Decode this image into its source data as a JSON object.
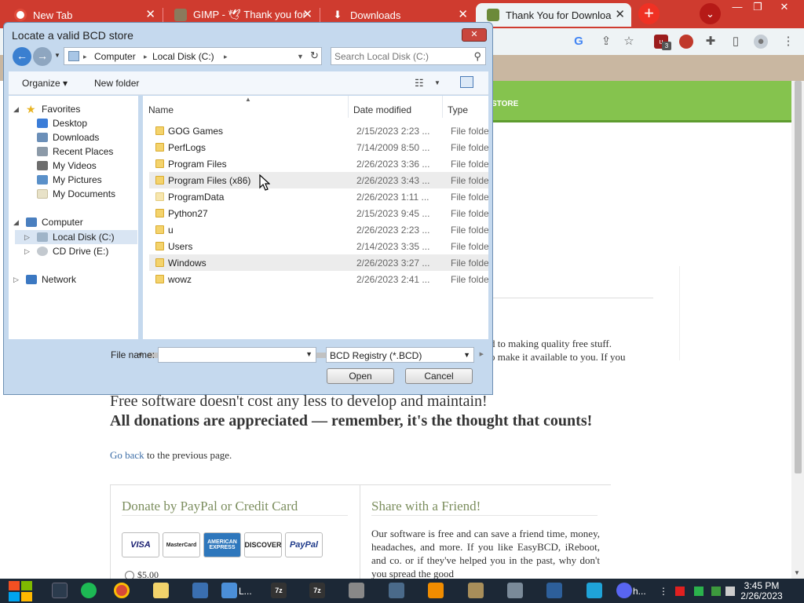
{
  "browser": {
    "tabs": [
      {
        "title": "New Tab",
        "active": false
      },
      {
        "title": "GIMP - 🕊 Thank you for",
        "active": false
      },
      {
        "title": "Downloads",
        "active": false
      },
      {
        "title": "Thank You for Downloa",
        "active": true
      }
    ],
    "new_tab_symbol": "+",
    "tab_menu_symbol": "⌄",
    "extension_badge": "3",
    "window_controls": {
      "minimize": "—",
      "restore": "❐",
      "close": "✕"
    }
  },
  "webpage": {
    "nav_banner_text": "STORE",
    "partial_text_line1": "d to making quality free stuff.",
    "partial_text_line2": "o make it available to you. If you",
    "free_line": "Free software doesn't cost any less to develop and maintain!",
    "donate_line": "All donations are appreciated — remember, it's the thought that counts!",
    "go_back_link": "Go back",
    "go_back_suffix": " to the previous page.",
    "donate_box": {
      "title": "Donate by PayPal or Credit Card",
      "cards": [
        "VISA",
        "MasterCard",
        "AMERICAN EXPRESS",
        "DISCOVER",
        "PayPal"
      ],
      "amount_option": "$5.00"
    },
    "share_box": {
      "title": "Share with a Friend!",
      "text": "Our software is free and can save a friend time, money, headaches, and more. If you like EasyBCD, iReboot, and co. or if they've helped you in the past, why don't you spread the good"
    }
  },
  "dialog": {
    "title": "Locate a valid BCD store",
    "close_symbol": "✕",
    "address_path": [
      "Computer",
      "Local Disk (C:)"
    ],
    "address_separator": "▸",
    "search_placeholder": "Search Local Disk (C:)",
    "toolbar": {
      "organize": "Organize ▾",
      "new_folder": "New folder"
    },
    "nav_tree": {
      "favorites": "Favorites",
      "favorites_items": [
        "Desktop",
        "Downloads",
        "Recent Places",
        "My Videos",
        "My Pictures",
        "My Documents"
      ],
      "computer": "Computer",
      "computer_items": [
        "Local Disk (C:)",
        "CD Drive (E:)"
      ],
      "network": "Network"
    },
    "columns": {
      "name": "Name",
      "date_modified": "Date modified",
      "type": "Type"
    },
    "files": [
      {
        "name": "GOG Games",
        "date": "2/15/2023 2:23 ...",
        "type": "File folder"
      },
      {
        "name": "PerfLogs",
        "date": "7/14/2009 8:50 ...",
        "type": "File folder"
      },
      {
        "name": "Program Files",
        "date": "2/26/2023 3:36 ...",
        "type": "File folder"
      },
      {
        "name": "Program Files (x86)",
        "date": "2/26/2023 3:43 ...",
        "type": "File folder"
      },
      {
        "name": "ProgramData",
        "date": "2/26/2023 1:11 ...",
        "type": "File folder"
      },
      {
        "name": "Python27",
        "date": "2/15/2023 9:45 ...",
        "type": "File folder"
      },
      {
        "name": "u",
        "date": "2/26/2023 2:23 ...",
        "type": "File folder"
      },
      {
        "name": "Users",
        "date": "2/14/2023 3:35 ...",
        "type": "File folder"
      },
      {
        "name": "Windows",
        "date": "2/26/2023 3:27 ...",
        "type": "File folder"
      },
      {
        "name": "wowz",
        "date": "2/26/2023 2:41 ...",
        "type": "File folder"
      }
    ],
    "file_name_label": "File name:",
    "file_name_value": "",
    "file_type_selected": "BCD Registry (*.BCD)",
    "open_button": "Open",
    "cancel_button": "Cancel"
  },
  "taskbar": {
    "app_label_short": "L...",
    "app_label_h": "h...",
    "clock_time": "3:45 PM",
    "clock_date": "2/26/2023"
  },
  "colors": {
    "chrome_red": "#cf3b2f",
    "banner_green": "#85c34e",
    "dialog_frame": "#c5d9ee",
    "taskbar": "#1c2836"
  }
}
